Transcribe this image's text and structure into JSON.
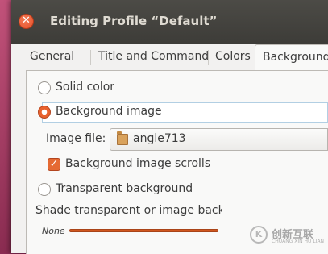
{
  "window": {
    "title": "Editing Profile “Default”",
    "close_glyph": "✕"
  },
  "tabs": [
    {
      "label": "General"
    },
    {
      "label": "Title and Command"
    },
    {
      "label": "Colors"
    },
    {
      "label": "Background",
      "active": true
    }
  ],
  "background": {
    "options": [
      {
        "label": "Solid color",
        "checked": false
      },
      {
        "label": "Background image",
        "checked": true
      },
      {
        "label": "Transparent background",
        "checked": false
      }
    ],
    "image_file_label": "Image file:",
    "image_file_value": "angle713",
    "scrolls_label": "Background image scrolls",
    "scrolls_checked": true,
    "check_glyph": "✓",
    "shade_label": "Shade transparent or image backgi",
    "shade_min_label": "None"
  },
  "watermark": {
    "logo_glyph": "K",
    "text": "创新互联",
    "sub": "CHUANG XIN HU LIAN"
  },
  "colors": {
    "accent": "#e8622f",
    "titlebar": "#3d3c38",
    "panel": "#f9f9f8"
  }
}
